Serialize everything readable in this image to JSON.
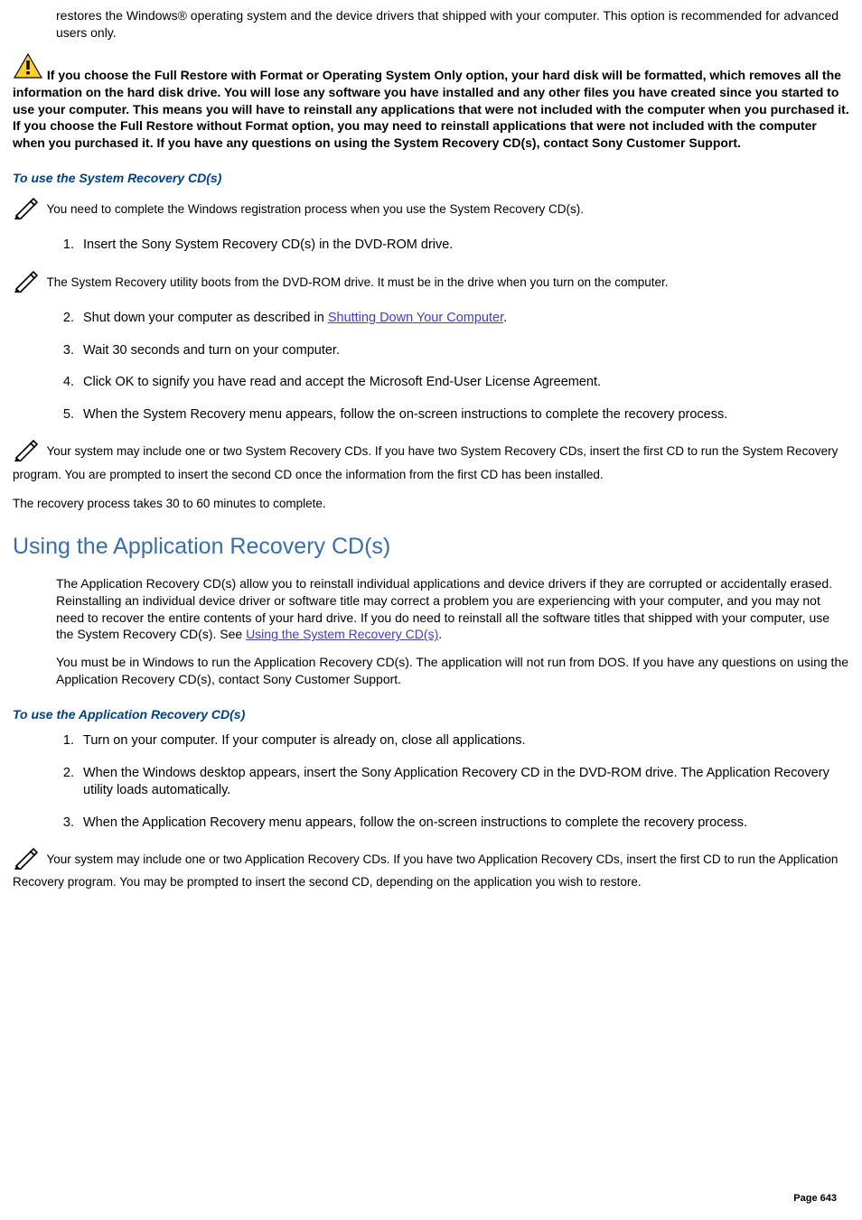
{
  "intro": {
    "p1": "restores the Windows® operating system and the device drivers that shipped with your computer. This option is recommended for advanced users only."
  },
  "warning": {
    "text": "If you choose the Full Restore with Format or Operating System Only option, your hard disk will be formatted, which removes all the information on the hard disk drive. You will lose any software you have installed and any other files you have created since you started to use your computer. This means you will have to reinstall any applications that were not included with the computer when you purchased it. If you choose the Full Restore without Format option, you may need to reinstall applications that were not included with the computer when you purchased it. If you have any questions on using the System Recovery CD(s), contact Sony Customer Support."
  },
  "sysrec": {
    "heading": "To use the System Recovery CD(s)",
    "note1": "You need to complete the Windows registration process when you use the System Recovery CD(s).",
    "step1": "Insert the Sony System Recovery CD(s) in the DVD-ROM drive.",
    "note2": "The System Recovery utility boots from the DVD-ROM drive. It must be in the drive when you turn on the computer.",
    "step2_a": "Shut down your computer as described in ",
    "step2_link": "Shutting Down Your Computer",
    "step2_b": ".",
    "step3": "Wait 30 seconds and turn on your computer.",
    "step4": "Click OK to signify you have read and accept the Microsoft End-User License Agreement.",
    "step5": "When the System Recovery menu appears, follow the on-screen instructions to complete the recovery process.",
    "note3": "Your system may include one or two System Recovery CDs. If you have two System Recovery CDs, insert the first CD to run the System Recovery program. You are prompted to insert the second CD once the information from the first CD has been installed.",
    "note4": "The recovery process takes 30 to 60 minutes to complete."
  },
  "apprec": {
    "title": "Using the Application Recovery CD(s)",
    "p1_a": "The Application Recovery CD(s) allow you to reinstall individual applications and device drivers if they are corrupted or accidentally erased. Reinstalling an individual device driver or software title may correct a problem you are experiencing with your computer, and you may not need to recover the entire contents of your hard drive. If you do need to reinstall all the software titles that shipped with your computer, use the System Recovery CD(s). See ",
    "p1_link": "Using the System Recovery CD(s)",
    "p1_b": ".",
    "p2": "You must be in Windows to run the Application Recovery CD(s). The application will not run from DOS. If you have any questions on using the Application Recovery CD(s), contact Sony Customer Support.",
    "heading": "To use the Application Recovery CD(s)",
    "step1": "Turn on your computer. If your computer is already on, close all applications.",
    "step2": "When the Windows desktop appears, insert the Sony Application Recovery CD in the DVD-ROM drive. The Application Recovery utility loads automatically.",
    "step3": "When the Application Recovery menu appears, follow the on-screen instructions to complete the recovery process.",
    "note1": "Your system may include one or two Application Recovery CDs. If you have two Application Recovery CDs, insert the first CD to run the Application Recovery program. You may be prompted to insert the second CD, depending on the application you wish to restore."
  },
  "page_label": "Page 643"
}
